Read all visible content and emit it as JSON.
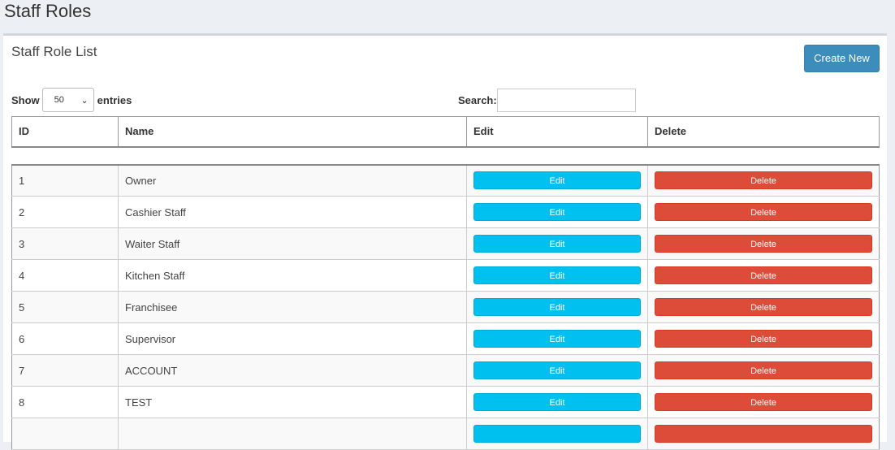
{
  "page": {
    "title": "Staff Roles"
  },
  "box": {
    "title": "Staff Role List",
    "create_label": "Create New"
  },
  "controls": {
    "show_label": "Show",
    "entries_value": "50",
    "entries_label": "entries",
    "search_label": "Search:",
    "search_value": ""
  },
  "table": {
    "headers": [
      "ID",
      "Name",
      "Edit",
      "Delete"
    ],
    "rows": [
      {
        "id": "1",
        "name": "Owner",
        "edit": "Edit",
        "delete": "Delete"
      },
      {
        "id": "2",
        "name": "Cashier Staff",
        "edit": "Edit",
        "delete": "Delete"
      },
      {
        "id": "3",
        "name": "Waiter Staff",
        "edit": "Edit",
        "delete": "Delete"
      },
      {
        "id": "4",
        "name": "Kitchen Staff",
        "edit": "Edit",
        "delete": "Delete"
      },
      {
        "id": "5",
        "name": "Franchisee",
        "edit": "Edit",
        "delete": "Delete"
      },
      {
        "id": "6",
        "name": "Supervisor",
        "edit": "Edit",
        "delete": "Delete"
      },
      {
        "id": "7",
        "name": "ACCOUNT",
        "edit": "Edit",
        "delete": "Delete"
      },
      {
        "id": "8",
        "name": "TEST",
        "edit": "Edit",
        "delete": "Delete"
      },
      {
        "id": "",
        "name": "",
        "edit": "",
        "delete": ""
      }
    ]
  },
  "colors": {
    "primary": "#3c8dbc",
    "info": "#00c0ef",
    "danger": "#dd4b39",
    "background": "#ecf0f5"
  }
}
